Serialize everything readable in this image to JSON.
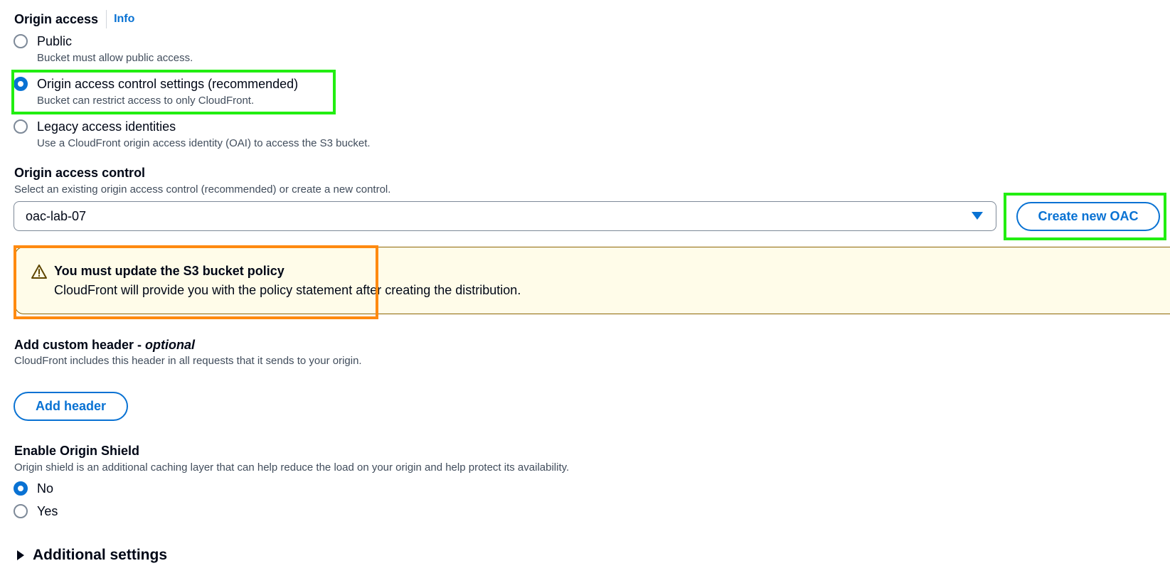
{
  "origin_access": {
    "label": "Origin access",
    "info_link": "Info",
    "options": [
      {
        "label": "Public",
        "description": "Bucket must allow public access.",
        "selected": false
      },
      {
        "label": "Origin access control settings (recommended)",
        "description": "Bucket can restrict access to only CloudFront.",
        "selected": true
      },
      {
        "label": "Legacy access identities",
        "description": "Use a CloudFront origin access identity (OAI) to access the S3 bucket.",
        "selected": false
      }
    ]
  },
  "origin_access_control": {
    "label": "Origin access control",
    "description": "Select an existing origin access control (recommended) or create a new control.",
    "selected_value": "oac-lab-07",
    "create_button": "Create new OAC"
  },
  "alert": {
    "title": "You must update the S3 bucket policy",
    "text": "CloudFront will provide you with the policy statement after creating the distribution."
  },
  "custom_header": {
    "label": "Add custom header - ",
    "label_optional": "optional",
    "description": "CloudFront includes this header in all requests that it sends to your origin.",
    "add_button": "Add header"
  },
  "origin_shield": {
    "label": "Enable Origin Shield",
    "description": "Origin shield is an additional caching layer that can help reduce the load on your origin and help protect its availability.",
    "options": [
      {
        "label": "No",
        "selected": true
      },
      {
        "label": "Yes",
        "selected": false
      }
    ]
  },
  "additional_settings": {
    "label": "Additional settings"
  },
  "colors": {
    "accent": "#0972d3",
    "highlight_green": "#22ee11",
    "highlight_orange": "#ff8a0f",
    "alert_bg": "#fffce9",
    "alert_border": "#8d6605"
  },
  "icons": {
    "alert": "warning-triangle-icon",
    "select": "caret-down-icon",
    "expand": "caret-right-icon"
  }
}
